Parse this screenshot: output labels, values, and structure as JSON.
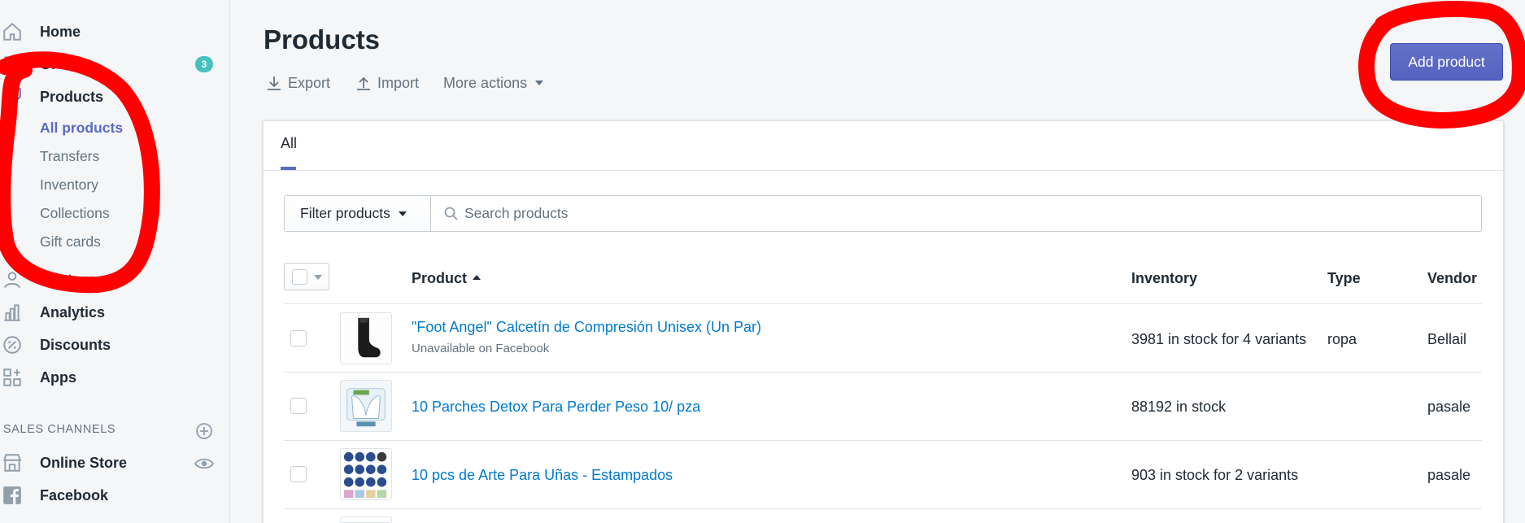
{
  "sidebar": {
    "items": [
      {
        "label": "Home",
        "icon": "home-icon"
      },
      {
        "label": "Orders",
        "icon": "orders-icon",
        "badge": "3"
      },
      {
        "label": "Products",
        "icon": "tag-icon"
      },
      {
        "label": "Customers",
        "icon": "customers-icon"
      },
      {
        "label": "Analytics",
        "icon": "analytics-icon"
      },
      {
        "label": "Discounts",
        "icon": "discount-icon"
      },
      {
        "label": "Apps",
        "icon": "apps-icon"
      }
    ],
    "product_subitems": [
      "All products",
      "Transfers",
      "Inventory",
      "Collections",
      "Gift cards"
    ],
    "sales_channels_title": "SALES CHANNELS",
    "channels": [
      {
        "label": "Online Store",
        "icon": "store-icon"
      },
      {
        "label": "Facebook",
        "icon": "facebook-icon"
      }
    ]
  },
  "header": {
    "title": "Products",
    "export_label": "Export",
    "import_label": "Import",
    "more_actions_label": "More actions",
    "add_product_label": "Add product"
  },
  "tabs": [
    {
      "label": "All",
      "active": true
    }
  ],
  "filter": {
    "button_label": "Filter products",
    "search_placeholder": "Search products"
  },
  "table": {
    "columns": [
      "Product",
      "Inventory",
      "Type",
      "Vendor"
    ],
    "rows": [
      {
        "name": "\"Foot Angel\" Calcetín de Compresión Unisex (Un Par)",
        "note": "Unavailable on Facebook",
        "inventory": "3981 in stock for 4 variants",
        "type": "ropa",
        "vendor": "Bellail"
      },
      {
        "name": "10 Parches Detox Para Perder Peso 10/ pza",
        "note": "",
        "inventory": "88192 in stock",
        "type": "",
        "vendor": "pasale"
      },
      {
        "name": "10 pcs de Arte Para Uñas - Estampados",
        "note": "",
        "inventory": "903 in stock for 2 variants",
        "type": "",
        "vendor": "pasale"
      }
    ]
  },
  "colors": {
    "accent": "#5c6ac4",
    "link": "#007ace",
    "badge": "#47c1bf",
    "annotation": "#ff0000"
  }
}
